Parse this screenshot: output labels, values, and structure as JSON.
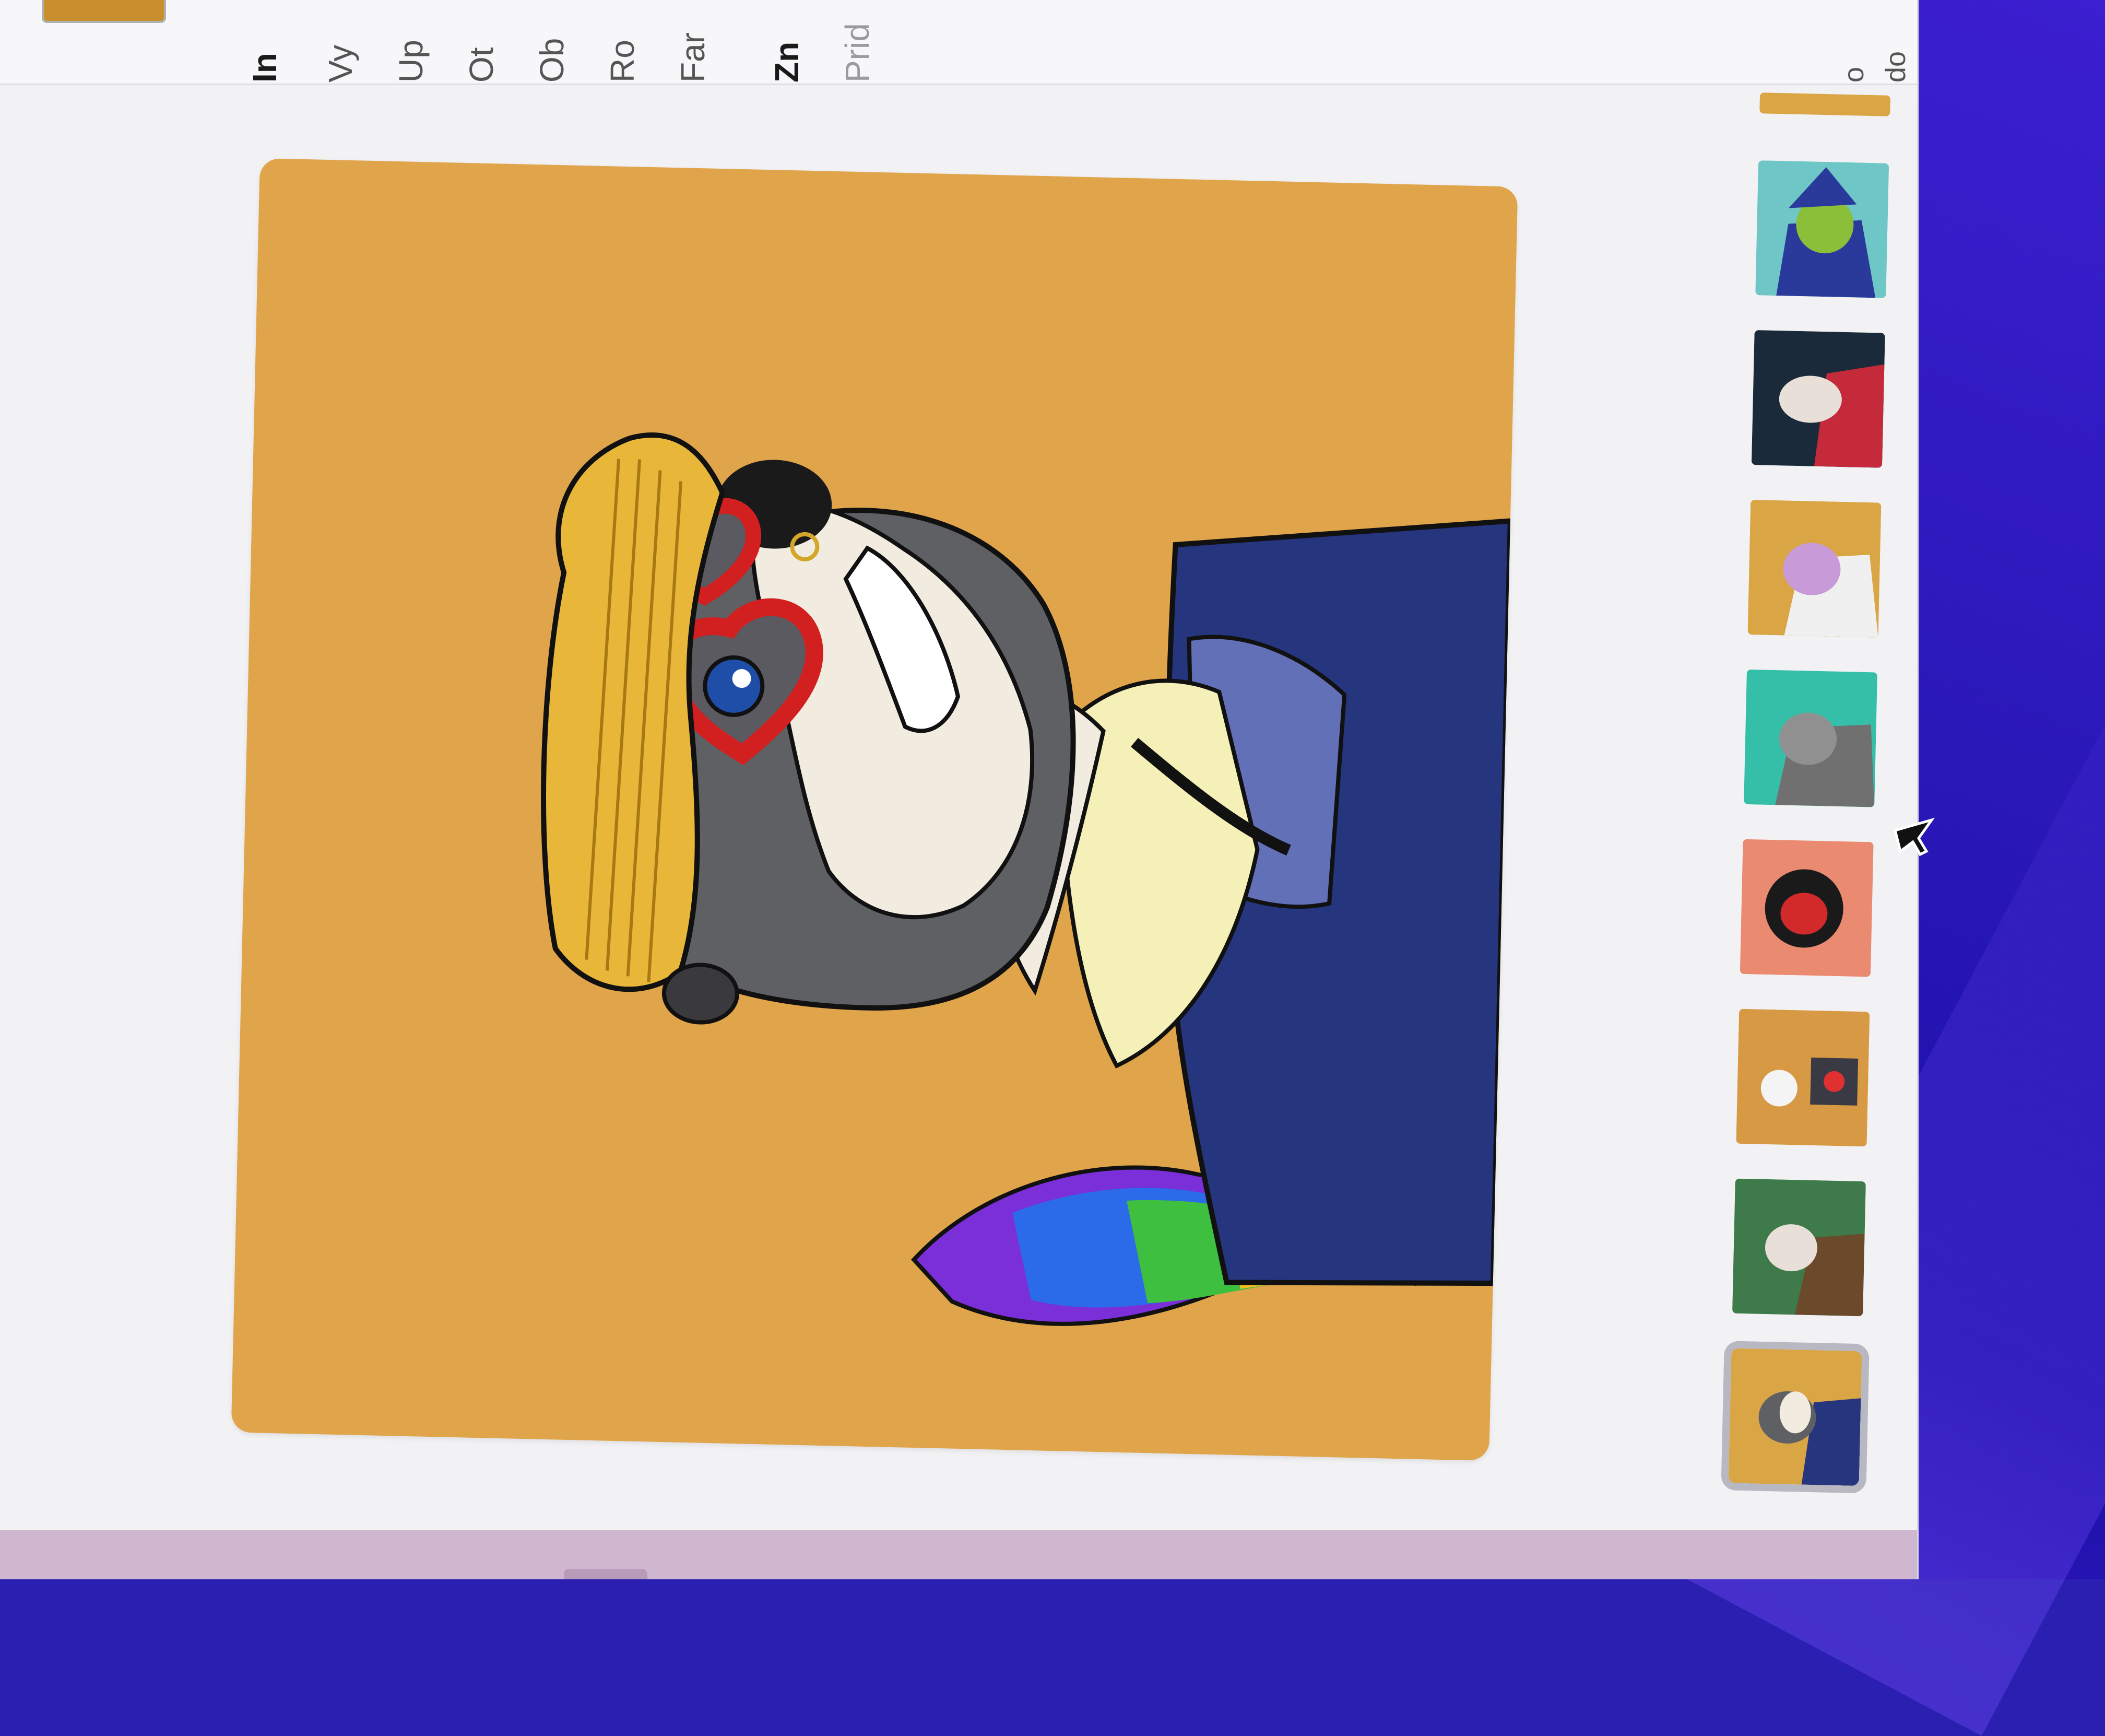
{
  "info_panel": {
    "heading": "In",
    "rows": [
      "Vy",
      "Up",
      "Ot",
      "Ob",
      "Ro",
      "Far"
    ],
    "section2_heading": "Zn",
    "section2_text": "Prid",
    "right_text": [
      "o",
      "do"
    ]
  },
  "thumbnails": {
    "items": [
      {
        "name": "thumb-wizard",
        "bg": "#6fc6c6"
      },
      {
        "name": "thumb-dark-red",
        "bg": "#1a2a3a"
      },
      {
        "name": "thumb-unicorn-cat",
        "bg": "#d9a545"
      },
      {
        "name": "thumb-cat-teal",
        "bg": "#36bfa8"
      },
      {
        "name": "thumb-red-face",
        "bg": "#ea8a70"
      },
      {
        "name": "thumb-robot-sunset",
        "bg": "#d89945"
      },
      {
        "name": "thumb-green",
        "bg": "#3f7a4a"
      },
      {
        "name": "thumb-badger-selected",
        "bg": "#d9a545",
        "selected": true
      }
    ]
  },
  "artwork": {
    "subject": "badger-nft-illustration",
    "background": "#e0a44a"
  },
  "colors": {
    "wallpaper": "#2a18b8",
    "page": "#f2f2f4",
    "strip": "#cfb7cf"
  }
}
